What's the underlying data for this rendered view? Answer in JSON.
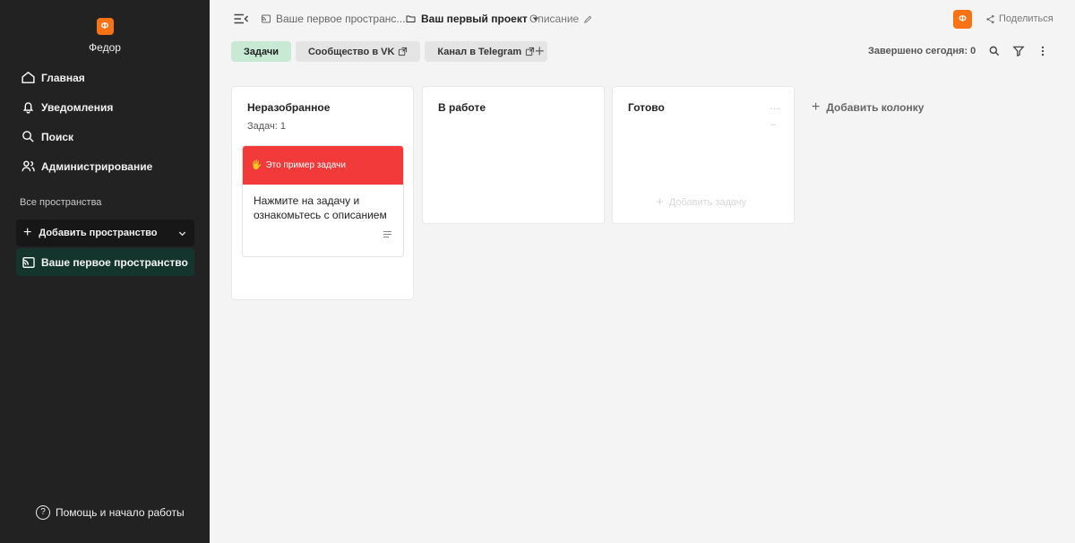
{
  "sidebar": {
    "user": {
      "initial": "Ф",
      "name": "Федор"
    },
    "nav": [
      {
        "label": "Главная",
        "icon": "home-icon"
      },
      {
        "label": "Уведомления",
        "icon": "bell-icon"
      },
      {
        "label": "Поиск",
        "icon": "search-icon"
      },
      {
        "label": "Администрирование",
        "icon": "users-icon"
      }
    ],
    "section_title": "Все пространства",
    "add_space_label": "Добавить пространство",
    "space_item_label": "Ваше первое пространство",
    "help_label": "Помощь и начало работы"
  },
  "header": {
    "space_crumb": "Ваше первое пространс...",
    "project_crumb": "Ваш первый проект",
    "description_label": "Описание",
    "avatar_initial": "Ф",
    "share_label": "Поделиться"
  },
  "tabs": [
    {
      "label": "Задачи",
      "active": true
    },
    {
      "label": "Сообщество в VK",
      "external": true
    },
    {
      "label": "Канал в Telegram",
      "external": true
    }
  ],
  "toolbar": {
    "done_today": "Завершено сегодня: 0"
  },
  "board": {
    "columns": [
      {
        "title": "Неразобранное",
        "count_label": "Задач: 1"
      },
      {
        "title": "В работе"
      },
      {
        "title": "Готово",
        "add_task_label": "Добавить задачу"
      }
    ],
    "task": {
      "emoji": "🖐",
      "tag_label": "Это пример задачи",
      "text": "Нажмите на задачу и ознакомьтесь с описанием"
    },
    "add_column_label": "Добавить колонку"
  },
  "colors": {
    "sidebar_bg": "#222223",
    "accent": "#f97316",
    "active_tab": "#c8ead4",
    "task_tag": "#f23a3a",
    "space_active": "#13352b"
  }
}
